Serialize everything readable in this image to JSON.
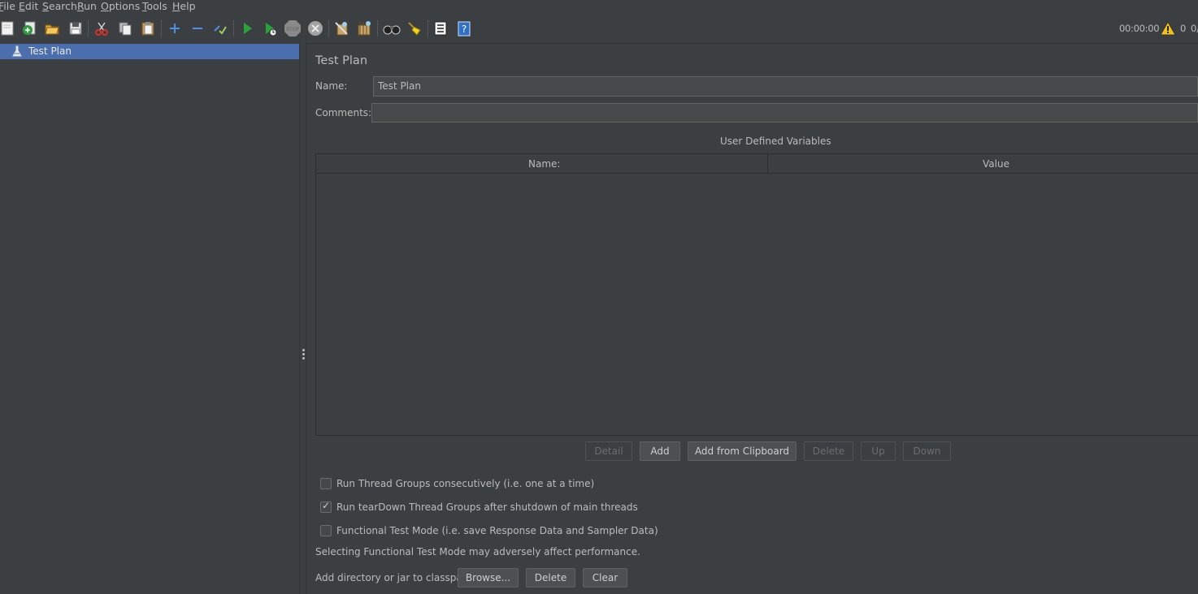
{
  "menu": {
    "items": [
      {
        "label": "File",
        "mnemonic": "F",
        "rest": "ile"
      },
      {
        "label": "Edit",
        "mnemonic": "E",
        "rest": "dit"
      },
      {
        "label": "Search",
        "mnemonic": "S",
        "rest": "earch"
      },
      {
        "label": "Run",
        "mnemonic": "R",
        "rest": "un"
      },
      {
        "label": "Options",
        "mnemonic": "O",
        "rest": "ptions"
      },
      {
        "label": "Tools",
        "mnemonic": "T",
        "rest": "ools"
      },
      {
        "label": "Help",
        "mnemonic": "H",
        "rest": "elp"
      }
    ]
  },
  "toolbar": {
    "icons": [
      "new-plan-icon",
      "templates-icon",
      "open-icon",
      "save-icon",
      "cut-icon",
      "copy-icon",
      "paste-icon",
      "expand-icon",
      "collapse-icon",
      "toggle-icon",
      "start-icon",
      "start-no-pause-icon",
      "stop-icon",
      "shutdown-icon",
      "clear-icon",
      "clear-all-icon",
      "search-icon",
      "reset-search-icon",
      "function-helper-icon",
      "help-icon"
    ],
    "timer": "00:00:00",
    "warning_count": "0",
    "thread_count": "0/"
  },
  "tree": {
    "items": [
      {
        "label": "Test Plan",
        "selected": true
      }
    ]
  },
  "panel": {
    "title": "Test Plan",
    "name_label": "Name:",
    "name_value": "Test Plan",
    "comments_label": "Comments:",
    "comments_value": "",
    "udv_title": "User Defined Variables",
    "columns": [
      "Name:",
      "Value"
    ],
    "rows": [],
    "buttons": {
      "detail": "Detail",
      "add": "Add",
      "add_clipboard": "Add from Clipboard",
      "delete": "Delete",
      "up": "Up",
      "down": "Down"
    },
    "checkboxes": [
      {
        "label": "Run Thread Groups consecutively (i.e. one at a time)",
        "checked": false
      },
      {
        "label": "Run tearDown Thread Groups after shutdown of main threads",
        "checked": true
      },
      {
        "label": "Functional Test Mode (i.e. save Response Data and Sampler Data)",
        "checked": false
      }
    ],
    "functional_note": "Selecting Functional Test Mode may adversely affect performance.",
    "classpath_label": "Add directory or jar to classpath",
    "classpath_buttons": {
      "browse": "Browse...",
      "delete": "Delete",
      "clear": "Clear"
    }
  }
}
